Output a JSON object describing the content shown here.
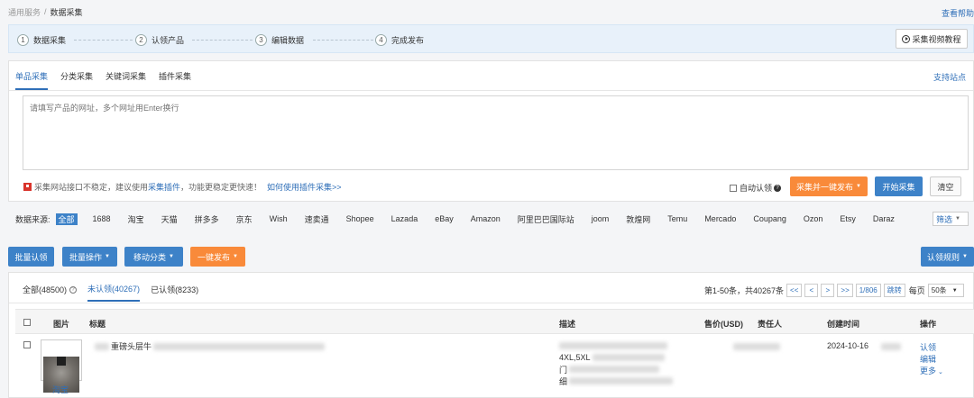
{
  "breadcrumb": {
    "root": "通用服务",
    "sep": "/",
    "current": "数据采集"
  },
  "help_link": "查看帮助",
  "steps": [
    {
      "num": "1",
      "label": "数据采集"
    },
    {
      "num": "2",
      "label": "认领产品"
    },
    {
      "num": "3",
      "label": "编辑数据"
    },
    {
      "num": "4",
      "label": "完成发布"
    }
  ],
  "video_button": "采集视频教程",
  "collect": {
    "tabs": [
      "单品采集",
      "分类采集",
      "关键词采集",
      "插件采集"
    ],
    "active_tab": 0,
    "support_link": "支持站点",
    "url_placeholder": "请填写产品的网址，多个网址用Enter换行",
    "notice_pre": "采集网站接口不稳定，建议使用",
    "notice_hl": "采集插件",
    "notice_post": "，功能更稳定更快速！",
    "notice_how": "如何使用插件采集>>",
    "auto_claim": "自动认领",
    "collect_publish_btn": "采集并一键发布",
    "start_btn": "开始采集",
    "clear_btn": "清空"
  },
  "sources": {
    "label": "数据来源:",
    "items": [
      "全部",
      "1688",
      "淘宝",
      "天猫",
      "拼多多",
      "京东",
      "Wish",
      "速卖通",
      "Shopee",
      "Lazada",
      "eBay",
      "Amazon",
      "阿里巴巴国际站",
      "joom",
      "敦煌网",
      "Temu",
      "Mercado",
      "Coupang",
      "Ozon",
      "Etsy",
      "Daraz"
    ],
    "active": 0,
    "filter": "筛选"
  },
  "actions": {
    "batch_claim": "批量认领",
    "batch_ops": "批量操作",
    "move_category": "移动分类",
    "one_click_publish": "一键发布",
    "claim_rules": "认领规则"
  },
  "status_tabs": [
    {
      "label": "全部(48500)"
    },
    {
      "label": "未认领(40267)"
    },
    {
      "label": "已认领(8233)"
    }
  ],
  "active_status": 1,
  "pager": {
    "summary": "第1-50条，共40267条",
    "first": "<<",
    "prev": "<",
    "next": ">",
    "last": ">>",
    "page": "1/806",
    "jump": "跳转",
    "per_page_label": "每页",
    "per_page": "50条"
  },
  "table": {
    "headers": {
      "image": "图片",
      "title": "标题",
      "desc": "描述",
      "price": "售价(USD)",
      "owner": "责任人",
      "created": "创建时间",
      "ops": "操作"
    },
    "rows": [
      {
        "title_visible": "重磅头层牛",
        "desc_lines": [
          "",
          "4XL,5XL",
          "门",
          "细"
        ],
        "source": "淘宝",
        "created": "2024-10-16",
        "ops": [
          "认领",
          "编辑",
          "更多"
        ]
      }
    ]
  }
}
